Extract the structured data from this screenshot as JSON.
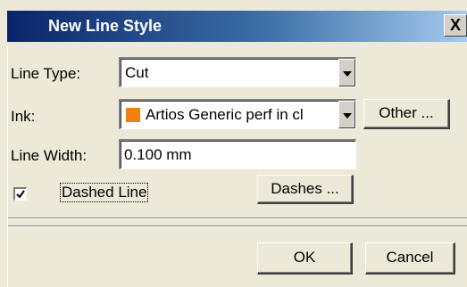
{
  "window": {
    "title": "New Line Style",
    "close_glyph": "X"
  },
  "form": {
    "line_type_label": "Line Type:",
    "line_type_value": "Cut",
    "ink_label": "Ink:",
    "ink_value": "Artios Generic perf in cl",
    "ink_color": "#f07f0c",
    "other_button": "Other ...",
    "line_width_label": "Line Width:",
    "line_width_value": "0.100 mm",
    "dashed_line_label": "Dashed Line",
    "dashed_line_checked": true,
    "dashes_button": "Dashes ..."
  },
  "footer": {
    "ok_button": "OK",
    "cancel_button": "Cancel"
  }
}
